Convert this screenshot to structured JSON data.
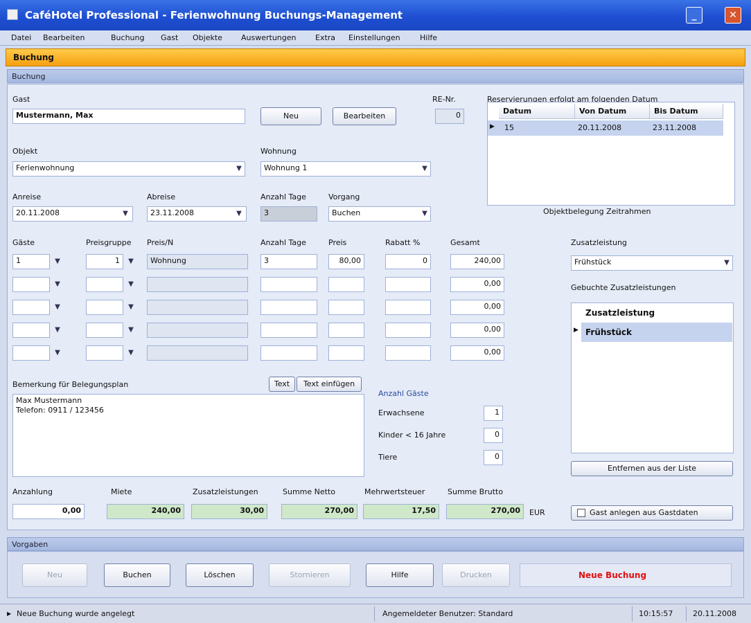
{
  "window": {
    "title": "CaféHotel Professional - Ferienwohnung Buchungs-Management",
    "minimize_glyph": "_",
    "close_glyph": "✕"
  },
  "menu": [
    "Datei",
    "Bearbeiten",
    "Buchung",
    "Gast",
    "Objekte",
    "Auswertungen",
    "Extra",
    "Einstellungen",
    "Hilfe"
  ],
  "section_title": "Buchung",
  "group_title": "Buchung",
  "guest": {
    "label": "Gast",
    "value": "Mustermann, Max",
    "new_button": "Neu",
    "search_button": "Bearbeiten"
  },
  "nr": {
    "label": "RE-Nr.",
    "value": "0"
  },
  "object": {
    "label": "Objekt",
    "value": "Ferienwohnung"
  },
  "room": {
    "label": "Wohnung",
    "value": "Wohnung 1"
  },
  "arrival": {
    "label": "Anreise",
    "value": "20.11.2008"
  },
  "departure": {
    "label": "Abreise",
    "value": "23.11.2008"
  },
  "days": {
    "label": "Anzahl Tage",
    "value": "3"
  },
  "booking_type": {
    "label": "Vorgang",
    "value": "Buchen"
  },
  "vacation_table": {
    "header": "Reservierungen erfolgt am folgenden Datum",
    "columns": [
      "Datum",
      "Von Datum",
      "Bis Datum"
    ],
    "rows": [
      [
        "15",
        "20.11.2008",
        "23.11.2008"
      ]
    ],
    "footer": "Objektbelegung Zeitrahmen"
  },
  "price_table": {
    "headers": [
      "Gäste",
      "Preisgruppe",
      "Preis/N",
      "Anzahl Tage",
      "Preis",
      "Rabatt %",
      "Gesamt"
    ],
    "rows": [
      [
        "1",
        "1",
        "Wohnung",
        "3",
        "80,00",
        "0",
        "240,00"
      ],
      [
        "",
        "",
        "",
        "",
        "",
        "",
        "0,00"
      ],
      [
        "",
        "",
        "",
        "",
        "",
        "",
        "0,00"
      ],
      [
        "",
        "",
        "",
        "",
        "",
        "",
        "0,00"
      ],
      [
        "",
        "",
        "",
        "",
        "",
        "",
        "0,00"
      ]
    ]
  },
  "extras": {
    "label": "Zusatzleistung",
    "value": "Frühstück",
    "list_label": "Gebuchte Zusatzleistungen",
    "items": [
      "Zusatzleistung",
      "Frühstück"
    ],
    "remove_button": "Entfernen aus der Liste"
  },
  "remarks": {
    "label": "Bemerkung für Belegungsplan",
    "button1": "Text",
    "button2": "Text einfügen",
    "text_line1": "Max Mustermann",
    "text_line2": "Telefon: 0911 / 123456"
  },
  "persons": {
    "title": "Anzahl Gäste",
    "rows": [
      {
        "label": "Erwachsene",
        "value": "1"
      },
      {
        "label": "Kinder < 16 Jahre",
        "value": "0"
      },
      {
        "label": "Tiere",
        "value": "0"
      }
    ]
  },
  "totals": {
    "labels": [
      "Anzahlung",
      "Miete",
      "Zusatzleistungen",
      "Summe Netto",
      "Mehrwertsteuer",
      "Summe Brutto"
    ],
    "values": [
      "0,00",
      "240,00",
      "30,00",
      "270,00",
      "17,50",
      "270,00"
    ],
    "currency": "EUR",
    "invoice_button": "Gast anlegen aus Gastdaten"
  },
  "actions": {
    "title": "Vorgaben",
    "buttons": [
      "Neu",
      "Buchen",
      "Löschen",
      "Stornieren",
      "Hilfe",
      "Drucken"
    ],
    "status_text": "Neue Buchung"
  },
  "statusbar": {
    "left": "Neue Buchung wurde angelegt",
    "middle": "Angemeldeter Benutzer: Standard",
    "time": "10:15:57",
    "date": "20.11.2008"
  },
  "colors": {
    "title_bar": "#1e4fd2",
    "accent_orange": "#f59f0f",
    "totals_green": "#cfe8c9",
    "status_red": "#e01010"
  }
}
